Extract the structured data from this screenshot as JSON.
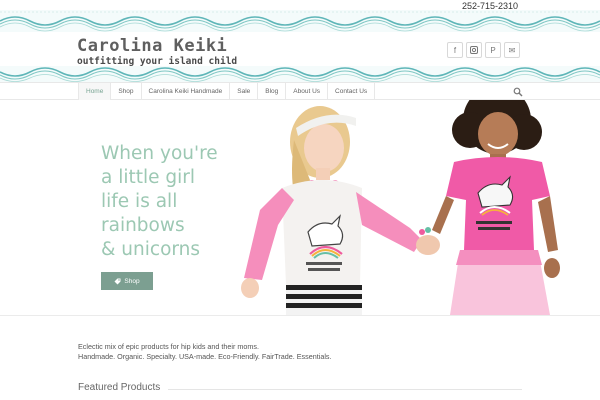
{
  "header": {
    "phone": "252-715-2310",
    "logo_title": "Carolina Keiki",
    "logo_tagline": "outfitting your island child",
    "social": [
      {
        "icon": "facebook-icon",
        "glyph": "f"
      },
      {
        "icon": "instagram-icon",
        "glyph": "◘"
      },
      {
        "icon": "pinterest-icon",
        "glyph": "P"
      },
      {
        "icon": "mail-icon",
        "glyph": "✉"
      }
    ]
  },
  "nav": {
    "items": [
      "Home",
      "Shop",
      "Carolina Keiki Handmade",
      "Sale",
      "Blog",
      "About Us",
      "Contact Us"
    ],
    "active": "Home"
  },
  "hero": {
    "heading_lines": [
      "When you're",
      "a little girl",
      "life is all",
      "rainbows",
      "& unicorns"
    ],
    "button_label": "Shop",
    "button_icon": "tag-icon"
  },
  "intro": {
    "line1": "Eclectic mix of epic products for hip kids and their moms.",
    "line2": "Handmade. Organic. Specialty. USA-made. Eco-Friendly. FairTrade. Essentials."
  },
  "featured": {
    "title": "Featured Products"
  },
  "colors": {
    "accent": "#9cc8b3",
    "button": "#7c9f91",
    "wave": "#5fb6b8",
    "pink": "#f07bb4"
  }
}
